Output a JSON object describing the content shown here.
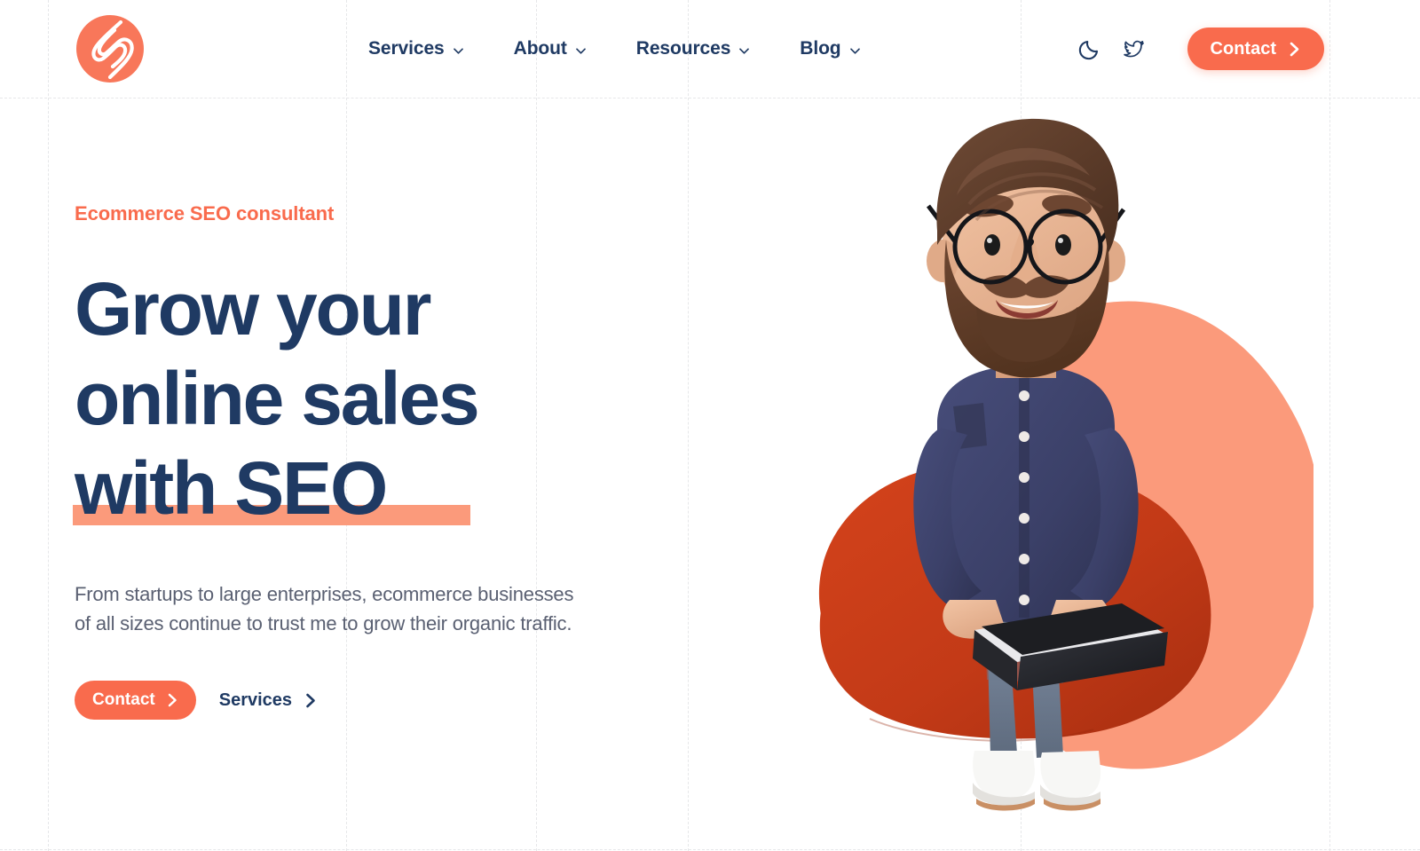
{
  "brand": {
    "logo_icon": "spiral-s-logo-icon",
    "accent_color": "#f96b4d",
    "navy_color": "#1f3a63",
    "blob_color": "#fb9a7b",
    "beanbag_color": "#c33a17"
  },
  "header": {
    "nav_items": [
      {
        "label": "Services",
        "has_dropdown": true
      },
      {
        "label": "About",
        "has_dropdown": true
      },
      {
        "label": "Resources",
        "has_dropdown": true
      },
      {
        "label": "Blog",
        "has_dropdown": true
      }
    ],
    "dark_mode_icon": "moon-icon",
    "social_icon": "twitter-icon",
    "contact_label": "Contact"
  },
  "hero": {
    "eyebrow": "Ecommerce SEO consultant",
    "headline_lines": [
      "Grow your",
      "online sales",
      "with SEO"
    ],
    "headline_full": "Grow your online sales with SEO",
    "paragraph_lines": [
      "From startups to large enterprises, ecommerce businesses",
      "of all sizes continue to trust me to grow their organic traffic."
    ],
    "primary_cta": "Contact",
    "secondary_cta": "Services",
    "illustration": "3d-man-on-beanbag-with-laptop"
  },
  "grid": {
    "vertical_lines": [
      54,
      390,
      604,
      775,
      1150,
      1498
    ],
    "horizontal_lines": [
      110,
      958
    ],
    "color": "#e6e7e9",
    "style": "dashed"
  }
}
